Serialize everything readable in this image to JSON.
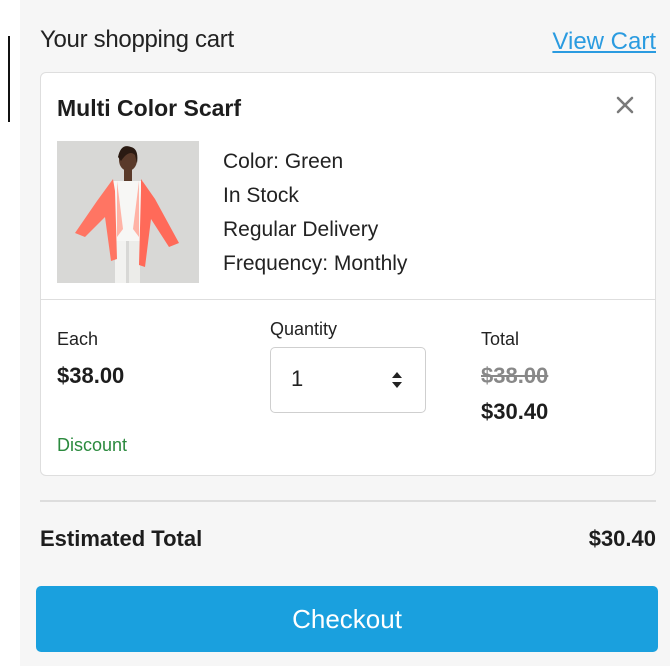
{
  "cart": {
    "title": "Your shopping cart",
    "view_cart_label": "View Cart"
  },
  "item": {
    "name": "Multi Color Scarf",
    "image_icon": "scarf-photo",
    "details": [
      "Color: Green",
      "In Stock",
      "Regular Delivery",
      "Frequency: Monthly"
    ],
    "each_label": "Each",
    "each_price": "$38.00",
    "quantity_label": "Quantity",
    "quantity_value": "1",
    "total_label": "Total",
    "total_original": "$38.00",
    "total_discounted": "$30.40",
    "discount_label": "Discount"
  },
  "summary": {
    "estimated_total_label": "Estimated Total",
    "estimated_total_value": "$30.40"
  },
  "checkout_label": "Checkout",
  "colors": {
    "accent": "#1aa0de",
    "link": "#2a9be0",
    "discount": "#2b8a3e"
  }
}
